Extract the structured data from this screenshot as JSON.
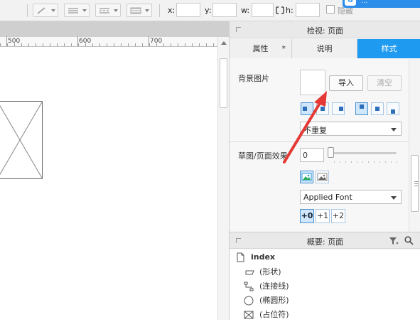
{
  "toolbar": {
    "x_label": "x:",
    "y_label": "y:",
    "w_label": "w:",
    "h_label": "h:",
    "hide_label": "隐藏",
    "top_right_label": "..."
  },
  "ruler": {
    "labels": [
      "500",
      "600",
      "700"
    ]
  },
  "inspector": {
    "title": "检视: 页面",
    "tabs": [
      {
        "label": "属性",
        "marker": "*"
      },
      {
        "label": "说明"
      },
      {
        "label": "样式"
      }
    ],
    "bg_image_label": "背景图片",
    "import_button": "导入",
    "clear_button": "清空",
    "repeat_select": "不重复",
    "sketch_label": "草图/页面效果",
    "sketch_value": "0",
    "font_select": "Applied Font",
    "font_steps": [
      "+0",
      "+1",
      "+2"
    ]
  },
  "overview": {
    "title": "概要: 页面",
    "items": [
      {
        "label": "index",
        "icon": "page-icon"
      },
      {
        "label": "(形状)",
        "icon": "shape-icon"
      },
      {
        "label": "(连接线)",
        "icon": "connector-icon"
      },
      {
        "label": "(椭圆形)",
        "icon": "ellipse-icon"
      },
      {
        "label": "(占位符)",
        "icon": "placeholder-icon"
      }
    ]
  },
  "colors": {
    "accent": "#1e9af0",
    "arrow": "#e53935"
  }
}
